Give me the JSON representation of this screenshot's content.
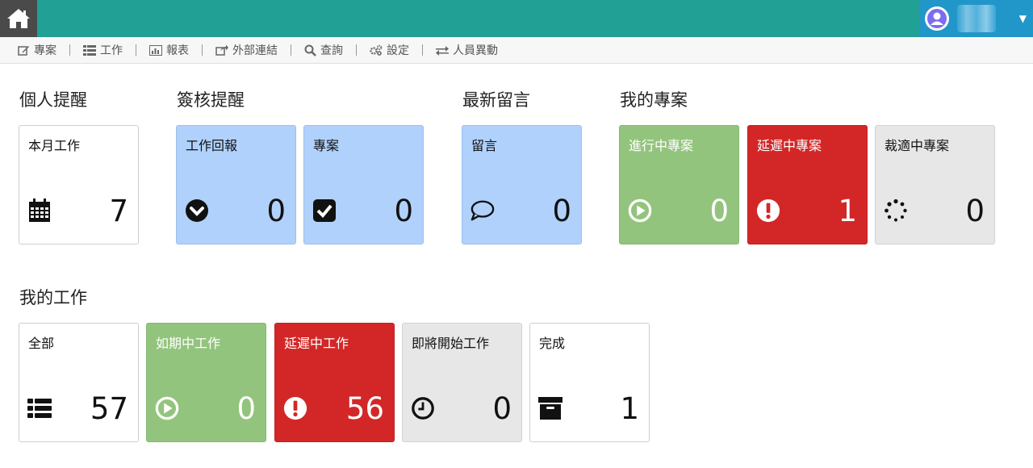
{
  "menu": {
    "items": [
      {
        "label": "專案",
        "icon": "edit-icon"
      },
      {
        "label": "工作",
        "icon": "list-icon"
      },
      {
        "label": "報表",
        "icon": "bar-chart-icon"
      },
      {
        "label": "外部連結",
        "icon": "share-icon"
      },
      {
        "label": "查詢",
        "icon": "search-icon"
      },
      {
        "label": "設定",
        "icon": "gears-icon"
      },
      {
        "label": "人員異動",
        "icon": "exchange-icon"
      }
    ]
  },
  "sections": {
    "personal": "個人提醒",
    "review": "簽核提醒",
    "messages": "最新留言",
    "projects": "我的專案",
    "tasks": "我的工作"
  },
  "cards": {
    "monthly_work": {
      "label": "本月工作",
      "count": "7"
    },
    "work_report": {
      "label": "工作回報",
      "count": "0"
    },
    "project_review": {
      "label": "專案",
      "count": "0"
    },
    "message": {
      "label": "留言",
      "count": "0"
    },
    "project_active": {
      "label": "進行中專案",
      "count": "0"
    },
    "project_delayed": {
      "label": "延遲中專案",
      "count": "1"
    },
    "project_cut": {
      "label": "裁適中專案",
      "count": "0"
    },
    "task_all": {
      "label": "全部",
      "count": "57"
    },
    "task_ontime": {
      "label": "如期中工作",
      "count": "0"
    },
    "task_delayed": {
      "label": "延遲中工作",
      "count": "56"
    },
    "task_upcoming": {
      "label": "即將開始工作",
      "count": "0"
    },
    "task_done": {
      "label": "完成",
      "count": "1"
    }
  },
  "colors": {
    "topbar": "#21a095",
    "blue_card": "#b0d1fb",
    "green_card": "#93c47d",
    "red_card": "#d32727",
    "gray_card": "#e7e7e7"
  }
}
